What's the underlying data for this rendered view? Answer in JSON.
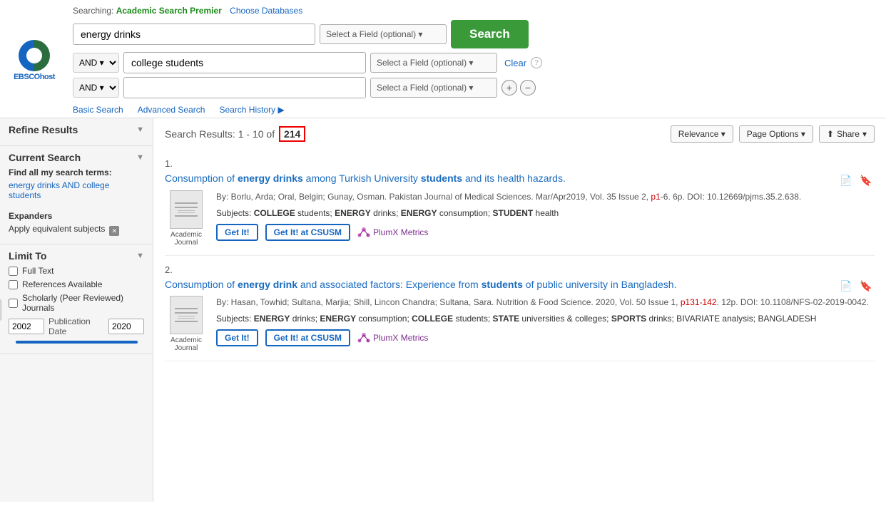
{
  "logo": {
    "name": "EBSCOhost",
    "host": "host"
  },
  "searching": {
    "label": "Searching:",
    "database": "Academic Search Premier",
    "choose_label": "Choose Databases"
  },
  "search_rows": [
    {
      "boolean": null,
      "value": "energy drinks",
      "field": "Select a Field (optional)"
    },
    {
      "boolean": "AND",
      "value": "college students",
      "field": "Select a Field (optional)"
    },
    {
      "boolean": "AND",
      "value": "",
      "field": "Select a Field (optional)"
    }
  ],
  "search_button": "Search",
  "clear_button": "Clear",
  "tabs": [
    {
      "id": "basic",
      "label": "Basic Search",
      "active": true
    },
    {
      "id": "advanced",
      "label": "Advanced Search",
      "active": false
    },
    {
      "id": "history",
      "label": "Search History ▶",
      "active": false
    }
  ],
  "sidebar": {
    "refine_title": "Refine Results",
    "current_search_title": "Current Search",
    "find_label": "Find all my search terms:",
    "search_terms": "energy drinks AND college students",
    "expanders_title": "Expanders",
    "apply_equivalent": "Apply equivalent subjects",
    "limit_to_title": "Limit To",
    "limit_options": [
      {
        "id": "full_text",
        "label": "Full Text",
        "checked": false
      },
      {
        "id": "references",
        "label": "References Available",
        "checked": false
      },
      {
        "id": "scholarly",
        "label": "Scholarly (Peer Reviewed) Journals",
        "checked": false
      }
    ],
    "pub_date_from": "2002",
    "pub_date_to": "2020",
    "pub_date_label": "Publication Date"
  },
  "results": {
    "label": "Search Results:",
    "range": "1 - 10 of",
    "total": "214",
    "sort_label": "Relevance",
    "page_options": "Page Options",
    "share_label": "Share",
    "items": [
      {
        "number": "1.",
        "title": "Consumption of energy drinks among Turkish University students and its health hazards.",
        "title_bold_terms": [
          "energy drinks",
          "students"
        ],
        "meta": "By: Borlu, Arda; Oral, Belgin; Gunay, Osman. Pakistan Journal of Medical Sciences. Mar/Apr2019, Vol. 35 Issue 2, p1-6. 6p. DOI: 10.12669/pjms.35.2.638.",
        "meta_link_text": "p1",
        "subjects": "Subjects: COLLEGE students; ENERGY drinks; ENERGY consumption; STUDENT health",
        "type": "Academic Journal",
        "actions": [
          "Get It!",
          "Get It! at CSUSM",
          "PlumX Metrics"
        ]
      },
      {
        "number": "2.",
        "title": "Consumption of energy drink and associated factors: Experience from students of public university in Bangladesh.",
        "title_bold_terms": [
          "energy drink",
          "students"
        ],
        "meta": "By: Hasan, Towhid; Sultana, Marjia; Shill, Lincon Chandra; Sultana, Sara. Nutrition & Food Science. 2020, Vol. 50 Issue 1, p131-142. 12p. DOI: 10.1108/NFS-02-2019-0042.",
        "meta_link_text": "p131-142",
        "subjects": "Subjects: ENERGY drinks; ENERGY consumption; COLLEGE students; STATE universities & colleges; SPORTS drinks; BIVARIATE analysis; BANGLADESH",
        "type": "Academic Journal",
        "actions": [
          "Get It!",
          "Get It! at CSUSM",
          "PlumX Metrics"
        ]
      }
    ]
  }
}
